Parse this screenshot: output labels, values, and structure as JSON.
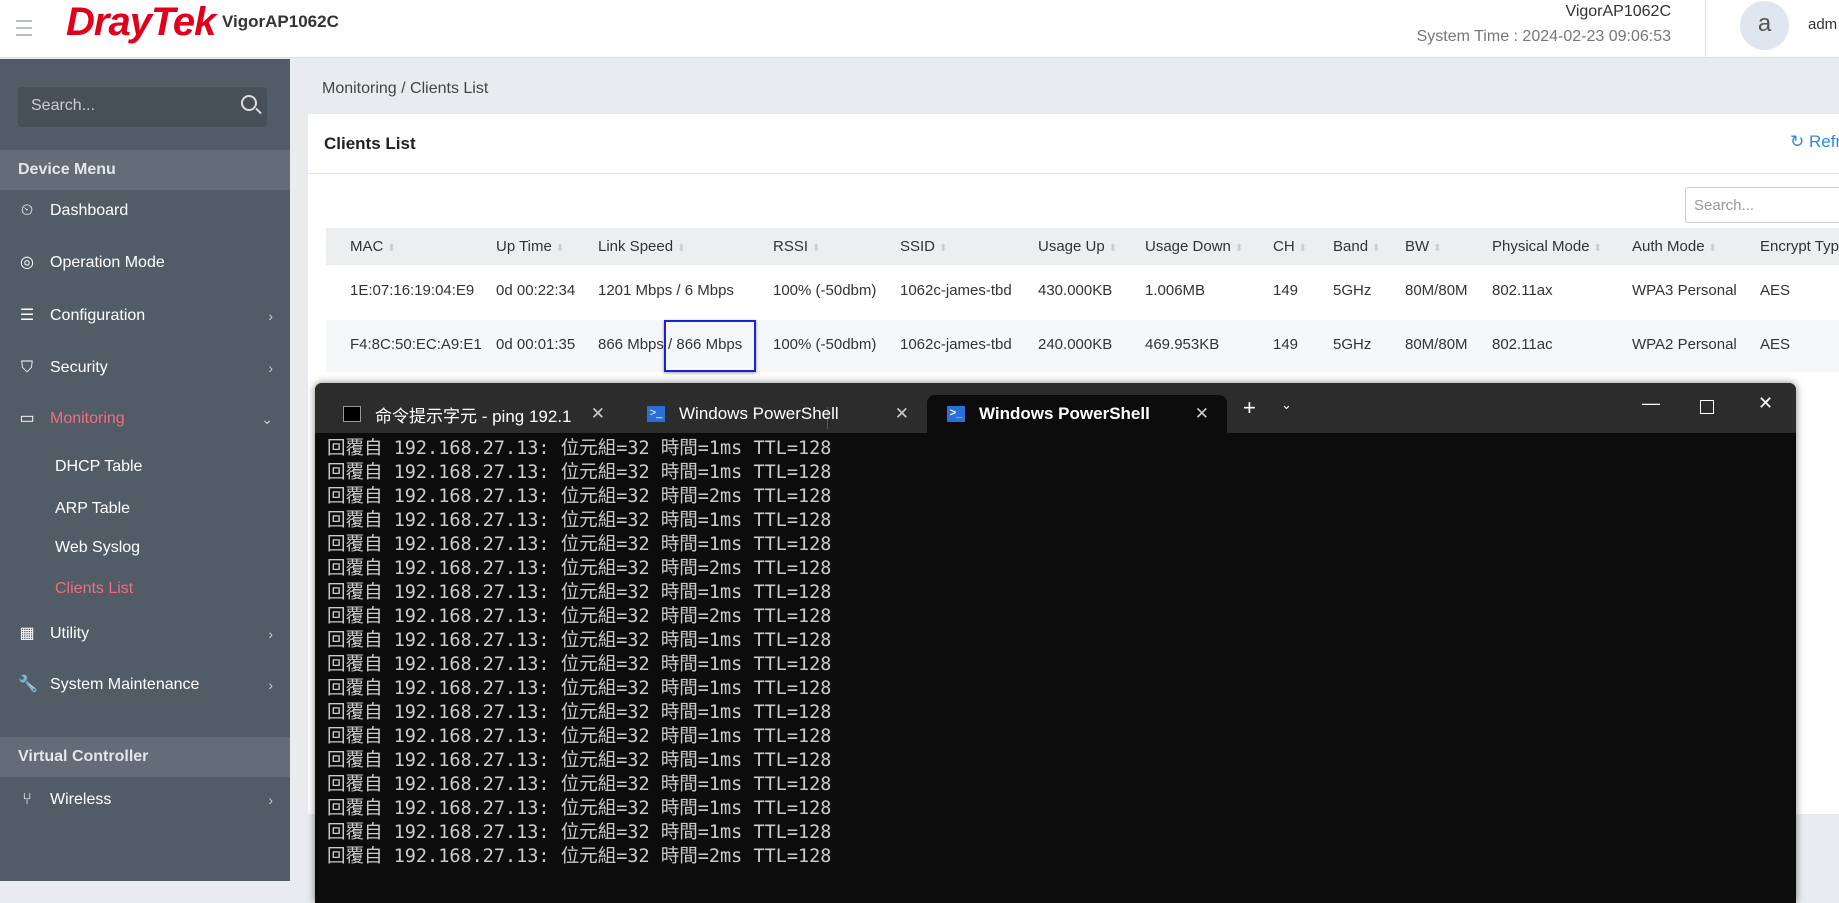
{
  "header": {
    "logo": "DrayTek",
    "model": "VigorAP1062C",
    "device_name": "VigorAP1062C",
    "system_time": "System Time : 2024-02-23 09:06:53",
    "avatar_letter": "a",
    "user": "adm"
  },
  "sidebar": {
    "search_placeholder": "Search...",
    "device_menu": "Device Menu",
    "items": [
      {
        "label": "Dashboard",
        "icon": "⏲"
      },
      {
        "label": "Operation Mode",
        "icon": "◎"
      },
      {
        "label": "Configuration",
        "icon": "☰",
        "chev": "›"
      },
      {
        "label": "Security",
        "icon": "⛉",
        "chev": "›"
      },
      {
        "label": "Monitoring",
        "icon": "▭",
        "chev": "⌄"
      }
    ],
    "monitoring_sub": [
      "DHCP Table",
      "ARP Table",
      "Web Syslog",
      "Clients List"
    ],
    "items2": [
      {
        "label": "Utility",
        "icon": "▦",
        "chev": "›"
      },
      {
        "label": "System Maintenance",
        "icon": "🔧",
        "chev": "›"
      }
    ],
    "virtual_controller": "Virtual Controller",
    "wireless": {
      "label": "Wireless",
      "icon": "⑂",
      "chev": "›"
    }
  },
  "breadcrumb": "Monitoring / Clients List",
  "card": {
    "title": "Clients List",
    "refresh": "Refr",
    "search_placeholder": "Search..."
  },
  "table": {
    "columns": [
      "MAC",
      "Up Time",
      "Link Speed",
      "RSSI",
      "SSID",
      "Usage Up",
      "Usage Down",
      "CH",
      "Band",
      "BW",
      "Physical Mode",
      "Auth Mode",
      "Encrypt Type"
    ],
    "rows": [
      [
        "1E:07:16:19:04:E9",
        "0d 00:22:34",
        "1201 Mbps / 6 Mbps",
        "100% (-50dbm)",
        "1062c-james-tbd",
        "430.000KB",
        "1.006MB",
        "149",
        "5GHz",
        "80M/80M",
        "802.11ax",
        "WPA3 Personal",
        "AES"
      ],
      [
        "F4:8C:50:EC:A9:E1",
        "0d 00:01:35",
        "866 Mbps / 866 Mbps",
        "100% (-50dbm)",
        "1062c-james-tbd",
        "240.000KB",
        "469.953KB",
        "149",
        "5GHz",
        "80M/80M",
        "802.11ac",
        "WPA2 Personal",
        "AES"
      ]
    ]
  },
  "terminal": {
    "tabs": [
      "命令提示字元 - ping  192.1",
      "Windows PowerShell",
      "Windows PowerShell"
    ],
    "lines": [
      "回覆自 192.168.27.13: 位元組=32 時間=1ms TTL=128",
      "回覆自 192.168.27.13: 位元組=32 時間=1ms TTL=128",
      "回覆自 192.168.27.13: 位元組=32 時間=2ms TTL=128",
      "回覆自 192.168.27.13: 位元組=32 時間=1ms TTL=128",
      "回覆自 192.168.27.13: 位元組=32 時間=1ms TTL=128",
      "回覆自 192.168.27.13: 位元組=32 時間=2ms TTL=128",
      "回覆自 192.168.27.13: 位元組=32 時間=1ms TTL=128",
      "回覆自 192.168.27.13: 位元組=32 時間=2ms TTL=128",
      "回覆自 192.168.27.13: 位元組=32 時間=1ms TTL=128",
      "回覆自 192.168.27.13: 位元組=32 時間=1ms TTL=128",
      "回覆自 192.168.27.13: 位元組=32 時間=1ms TTL=128",
      "回覆自 192.168.27.13: 位元組=32 時間=1ms TTL=128",
      "回覆自 192.168.27.13: 位元組=32 時間=1ms TTL=128",
      "回覆自 192.168.27.13: 位元組=32 時間=1ms TTL=128",
      "回覆自 192.168.27.13: 位元組=32 時間=1ms TTL=128",
      "回覆自 192.168.27.13: 位元組=32 時間=1ms TTL=128",
      "回覆自 192.168.27.13: 位元組=32 時間=1ms TTL=128",
      "回覆自 192.168.27.13: 位元組=32 時間=2ms TTL=128"
    ]
  }
}
